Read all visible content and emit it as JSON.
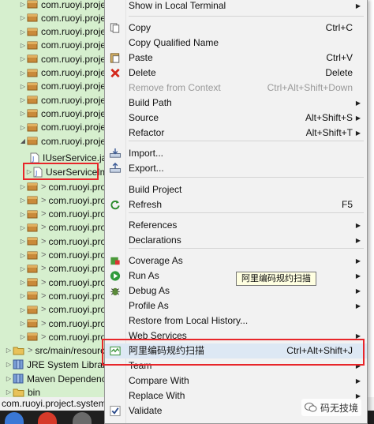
{
  "tree": {
    "rows": [
      {
        "label": "com.ruoyi.project"
      },
      {
        "label": "com.ruoyi.project"
      },
      {
        "label": "com.ruoyi.project"
      },
      {
        "label": "com.ruoyi.project"
      },
      {
        "label": "com.ruoyi.project"
      },
      {
        "label": "com.ruoyi.project"
      },
      {
        "label": "com.ruoyi.project"
      },
      {
        "label": "com.ruoyi.project"
      },
      {
        "label": "com.ruoyi.project"
      },
      {
        "label": "com.ruoyi.project"
      },
      {
        "label": "com.ruoyi.project"
      }
    ],
    "iuserservice": "IUserService.ja",
    "userserviceimpl": "UserServiceIm",
    "sub_rows": [
      {
        "label": "com.ruoyi.proje"
      },
      {
        "label": "com.ruoyi.proje"
      },
      {
        "label": "com.ruoyi.proje"
      },
      {
        "label": "com.ruoyi.proje"
      },
      {
        "label": "com.ruoyi.proje"
      },
      {
        "label": "com.ruoyi.proje"
      },
      {
        "label": "com.ruoyi.proje"
      },
      {
        "label": "com.ruoyi.proje"
      },
      {
        "label": "com.ruoyi.proje"
      },
      {
        "label": "com.ruoyi.proje"
      },
      {
        "label": "com.ruoyi.proje"
      },
      {
        "label": "com.ruoyi.proje"
      }
    ],
    "src_main_resources": "src/main/resourc",
    "jre": "JRE System Library",
    "maven": "Maven Dependencie",
    "bin": "bin"
  },
  "status": {
    "path": "com.ruoyi.project.system.u"
  },
  "menu": {
    "items": [
      {
        "label": "Show in Local Terminal",
        "accel": "",
        "submenu": true
      },
      {
        "label": "Copy",
        "accel": "Ctrl+C",
        "icon": "copy-icon"
      },
      {
        "label": "Copy Qualified Name",
        "accel": ""
      },
      {
        "label": "Paste",
        "accel": "Ctrl+V",
        "icon": "paste-icon"
      },
      {
        "label": "Delete",
        "accel": "Delete",
        "icon": "delete-icon"
      },
      {
        "label": "Remove from Context",
        "accel": "Ctrl+Alt+Shift+Down",
        "disabled": true
      },
      {
        "label": "Build Path",
        "accel": "",
        "submenu": true
      },
      {
        "label": "Source",
        "accel": "Alt+Shift+S",
        "submenu": true
      },
      {
        "label": "Refactor",
        "accel": "Alt+Shift+T",
        "submenu": true
      },
      {
        "label": "Import...",
        "accel": "",
        "icon": "import-icon"
      },
      {
        "label": "Export...",
        "accel": "",
        "icon": "export-icon"
      },
      {
        "label": "Build Project",
        "accel": ""
      },
      {
        "label": "Refresh",
        "accel": "F5",
        "icon": "refresh-icon"
      },
      {
        "label": "References",
        "accel": "",
        "submenu": true
      },
      {
        "label": "Declarations",
        "accel": "",
        "submenu": true
      },
      {
        "label": "Coverage As",
        "accel": "",
        "submenu": true,
        "icon": "coverage-icon"
      },
      {
        "label": "Run As",
        "accel": "",
        "submenu": true,
        "icon": "run-icon"
      },
      {
        "label": "Debug As",
        "accel": "",
        "submenu": true,
        "icon": "debug-icon"
      },
      {
        "label": "Profile As",
        "accel": "",
        "submenu": true
      },
      {
        "label": "Restore from Local History...",
        "accel": ""
      },
      {
        "label": "Web Services",
        "accel": "",
        "submenu": true
      },
      {
        "label": "阿里编码规约扫描",
        "accel": "Ctrl+Alt+Shift+J",
        "icon": "p3c-scan-icon"
      },
      {
        "label": "Team",
        "accel": "",
        "submenu": true
      },
      {
        "label": "Compare With",
        "accel": "",
        "submenu": true
      },
      {
        "label": "Replace With",
        "accel": "",
        "submenu": true
      },
      {
        "label": "Validate",
        "accel": "",
        "icon": "validate-check-icon"
      }
    ],
    "tooltip": "阿里编码规约扫描"
  },
  "watermark": {
    "text": "码无技境"
  },
  "colors": {
    "tree_bg": "#d6efce",
    "menu_bg": "#f2f2f2",
    "highlight_red": "#e8262a",
    "tooltip_bg": "#ffffe1"
  }
}
